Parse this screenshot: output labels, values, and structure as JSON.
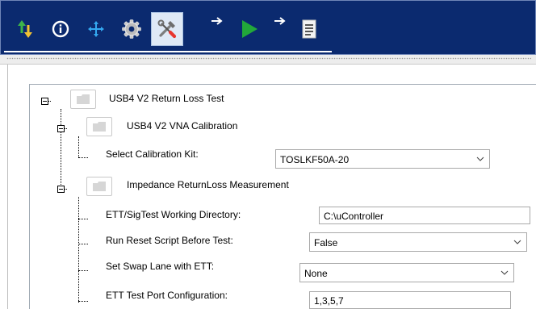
{
  "toolbar": {
    "buttons": [
      {
        "icon": "sort-arrows-icon"
      },
      {
        "icon": "info-icon"
      },
      {
        "icon": "move-arrows-icon"
      },
      {
        "icon": "gear-icon"
      },
      {
        "icon": "tools-icon",
        "selected": true
      },
      {
        "icon": "arrow-right-icon"
      },
      {
        "icon": "play-icon"
      },
      {
        "icon": "arrow-right-icon"
      },
      {
        "icon": "report-icon"
      }
    ],
    "colors": {
      "background": "#0b2a6f",
      "selected": "#dfe9f6"
    }
  },
  "tree": {
    "root": {
      "label": "USB4 V2 Return Loss Test"
    },
    "calibration": {
      "label": "USB4 V2 VNA Calibration",
      "select_kit": {
        "label": "Select Calibration Kit:",
        "value": "TOSLKF50A-20"
      }
    },
    "measurement": {
      "label": "Impedance  ReturnLoss Measurement",
      "working_dir": {
        "label": "ETT/SigTest Working Directory:",
        "value": "C:\\uController"
      },
      "reset_script": {
        "label": "Run Reset Script Before Test:",
        "value": "False"
      },
      "swap_lane": {
        "label": "Set Swap Lane with ETT:",
        "value": "None"
      },
      "port_config": {
        "label": "ETT Test Port Configuration:",
        "value": "1,3,5,7"
      }
    }
  }
}
